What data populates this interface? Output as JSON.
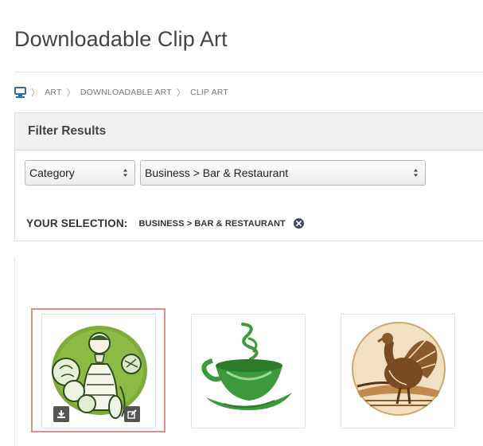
{
  "page": {
    "title": "Downloadable Clip Art"
  },
  "breadcrumb": {
    "home_icon": "home-computer-icon",
    "items": [
      "ART",
      "DOWNLOADABLE ART",
      "CLIP ART"
    ]
  },
  "filter": {
    "header": "Filter Results",
    "category_select": {
      "selected": "Category"
    },
    "subcategory_select": {
      "selected": "Business > Bar & Restaurant"
    },
    "selection_label": "YOUR SELECTION:",
    "selection_value": "BUSINESS > BAR & RESTAURANT",
    "remove_icon": "close-circle-icon"
  },
  "results": [
    {
      "name": "farmer-with-vegetables",
      "selected": true,
      "actions": [
        "download-icon",
        "edit-icon"
      ]
    },
    {
      "name": "green-teacup",
      "selected": false
    },
    {
      "name": "wild-turkey",
      "selected": false
    }
  ],
  "colors": {
    "selection_border": "#e68a8a",
    "card_border": "#d8e4ec",
    "header_bg": "#f1f1f1",
    "icon_blue": "#2a6db5",
    "remove_icon": "#3b4a6b"
  }
}
